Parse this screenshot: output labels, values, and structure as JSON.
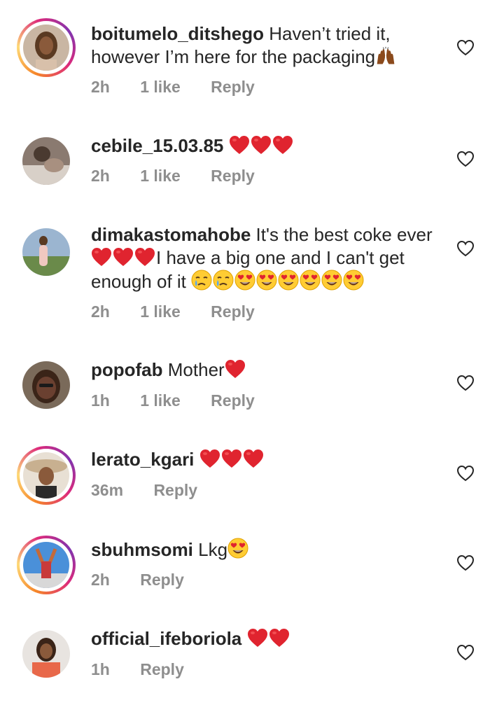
{
  "comments": [
    {
      "username": "boitumelo_ditshego",
      "text": "Haven’t tried it, however I’m here for the packaging",
      "time": "2h",
      "likes": "1 like",
      "reply": "Reply"
    },
    {
      "username": "cebile_15.03.85",
      "text": "",
      "time": "2h",
      "likes": "1 like",
      "reply": "Reply"
    },
    {
      "username": "dimakastomahobe",
      "text_a": "It's the best coke ever",
      "text_b": "I have a big one and I can't get enough of it",
      "time": "2h",
      "likes": "1 like",
      "reply": "Reply"
    },
    {
      "username": "popofab",
      "text": "Mother",
      "time": "1h",
      "likes": "1 like",
      "reply": "Reply"
    },
    {
      "username": "lerato_kgari",
      "text": "",
      "time": "36m",
      "reply": "Reply"
    },
    {
      "username": "sbuhmsomi",
      "text": "Lkg",
      "time": "2h",
      "reply": "Reply"
    },
    {
      "username": "official_ifeboriola",
      "text": "",
      "time": "1h",
      "reply": "Reply"
    }
  ],
  "colors": {
    "text": "#262626",
    "meta": "#8e8e8e",
    "heart_emoji": "#e0242f",
    "ring_start": "#f58529",
    "ring_end": "#dd2a7b"
  },
  "icons": {
    "like": "heart-outline-icon",
    "emoji_heart": "red-heart-emoji",
    "emoji_hands": "raising-hands-emoji",
    "emoji_crying": "crying-face-emoji",
    "emoji_heart_eyes": "heart-eyes-emoji"
  }
}
